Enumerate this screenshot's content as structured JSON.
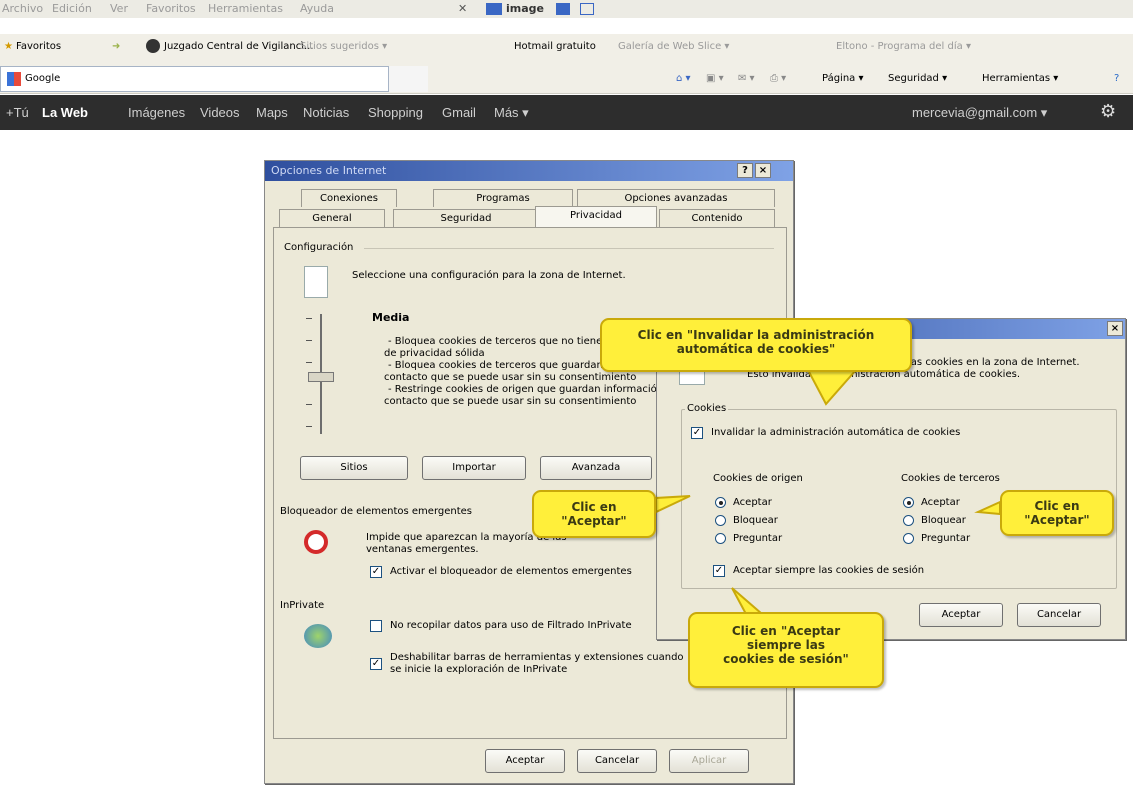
{
  "menubar": {
    "items": [
      "Archivo",
      "Edición",
      "Ver",
      "Favoritos",
      "Herramientas",
      "Ayuda"
    ],
    "image_label": "image"
  },
  "favbar": {
    "favorites": "Favoritos",
    "juzgado": "Juzgado Central de Vigilancì...",
    "sitios": "Sitios sugeridos ▾",
    "hotmail": "Hotmail gratuito",
    "galeria": "Galería de Web Slice ▾",
    "eltono": "Eltono - Programa del día ▾"
  },
  "addrbar": {
    "tab_title": "Google",
    "pagina": "Página ▾",
    "seguridad": "Seguridad ▾",
    "herramientas": "Herramientas ▾"
  },
  "gbar": {
    "items": [
      "+Tú",
      "La Web",
      "Imágenes",
      "Videos",
      "Maps",
      "Noticias",
      "Shopping",
      "Gmail",
      "Más ▾"
    ],
    "account": "mercevia@gmail.com ▾"
  },
  "options_dialog": {
    "title": "Opciones de Internet",
    "help": "?",
    "close": "×",
    "tabs_back": [
      "Conexiones",
      "Programas",
      "Opciones avanzadas"
    ],
    "tabs_front": [
      "General",
      "Seguridad",
      "Privacidad",
      "Contenido"
    ],
    "config_label": "Configuración",
    "config_desc": "Seleccione una configuración para la zona de Internet.",
    "level_title": "Media",
    "level_lines": [
      "- Bloquea cookies de terceros que no tienen una directiva",
      "de privacidad sólida",
      "- Bloquea cookies de terceros que guardan información de",
      "contacto que se puede usar sin su consentimiento",
      "- Restringe cookies de origen que guardan información de",
      "contacto que se puede usar sin su consentimiento"
    ],
    "buttons_row": [
      "Sitios",
      "Importar",
      "Avanzada"
    ],
    "popup_label": "Bloqueador de elementos emergentes",
    "popup_desc": [
      "Impide que aparezcan la mayoría de las",
      "ventanas emergentes."
    ],
    "popup_check": "Activar el bloqueador de elementos emergentes",
    "inprivate_label": "InPrivate",
    "inprivate_check1": "No recopilar datos para uso de Filtrado InPrivate",
    "inprivate_check2": [
      "Deshabilitar barras de herramientas y extensiones cuando",
      "se inicie la exploración de InPrivate"
    ],
    "ok": "Aceptar",
    "cancel": "Cancelar",
    "apply": "Aplicar"
  },
  "advanced_dialog": {
    "close": "×",
    "desc_lines": [
      "Puede elegir cómo se controlan las cookies en la zona de Internet.",
      "Esto invalida la administración automática de cookies."
    ],
    "cookies_label": "Cookies",
    "override_check": "Invalidar la administración automática de cookies",
    "first_party_label": "Cookies de origen",
    "third_party_label": "Cookies de terceros",
    "options": [
      "Aceptar",
      "Bloquear",
      "Preguntar"
    ],
    "session_check": "Aceptar siempre las cookies de sesión",
    "ok": "Aceptar",
    "cancel": "Cancelar"
  },
  "callouts": {
    "override": [
      "Clic en \"Invalidar la administración",
      "automática de cookies\""
    ],
    "accept_first": [
      "Clic en",
      "\"Aceptar\""
    ],
    "accept_third": [
      "Clic en",
      "\"Aceptar\""
    ],
    "session": [
      "Clic en \"Aceptar",
      "siempre las",
      "cookies de sesión\""
    ]
  },
  "colors": {
    "callout_fill": "#ffef3a",
    "google_bar": "#2d2d2d",
    "dialog_bg": "#ece9d8",
    "titlebar": "#2f4f9e"
  }
}
